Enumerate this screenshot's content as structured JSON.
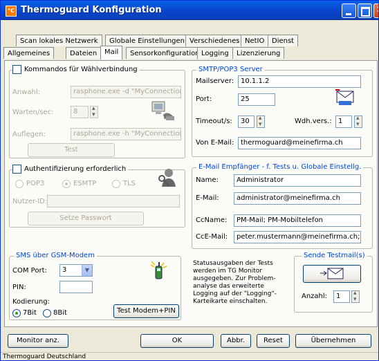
{
  "window": {
    "title": "Thermoguard Konfiguration",
    "icon_text": "°C"
  },
  "tabs_row1": [
    "Scan lokales Netzwerk",
    "Globale Einstellungen",
    "Verschiedenes",
    "NetIO",
    "Dienst"
  ],
  "tabs_row2": [
    "Allgemeines",
    "Dateien",
    "Mail",
    "Sensorkonfiguration",
    "Logging",
    "Lizenzierung"
  ],
  "selected_tab": "Mail",
  "dialup": {
    "title": "Kommandos für Wählverbindung",
    "dial_label": "Anwahl:",
    "dial_value": "rasphone.exe -d \"MyConnection",
    "wait_label": "Warten/sec:",
    "wait_value": "8",
    "hangup_label": "Auflegen:",
    "hangup_value": "rasphone.exe -h \"MyConnection",
    "test_button": "Test"
  },
  "auth": {
    "title": "Authentifizierung erforderlich",
    "options": [
      "POP3",
      "ESMTP",
      "TLS"
    ],
    "selected": "ESMTP",
    "user_label": "Nutzer-ID:",
    "user_value": "",
    "password_button": "Setze Passwort"
  },
  "sms": {
    "title": "SMS über GSM-Modem",
    "com_label": "COM Port:",
    "com_value": "3",
    "pin_label": "PIN:",
    "pin_value": "",
    "encoding_label": "Kodierung:",
    "encoding_options": [
      "7Bit",
      "8Bit"
    ],
    "encoding_selected": "7Bit",
    "test_button": "Test Modem+PIN"
  },
  "smtp": {
    "title": "SMTP/POP3 Server",
    "server_label": "Mailserver:",
    "server_value": "10.1.1.2",
    "port_label": "Port:",
    "port_value": "25",
    "timeout_label": "Timeout/s:",
    "timeout_value": "30",
    "retry_label": "Wdh.vers.:",
    "retry_value": "1",
    "from_label": "Von E-Mail:",
    "from_value": "thermoguard@meinefirma.ch"
  },
  "recipient": {
    "title": "E-Mail Empfänger - f. Tests u. Globale Einstellg.",
    "name_label": "Name:",
    "name_value": "Administrator",
    "email_label": "E-Mail:",
    "email_value": "administrator@meinefirma.ch",
    "ccname_label": "CcName:",
    "ccname_value": "PM-Mail; PM-Mobiltelefon",
    "ccemail_label": "CcE-Mail:",
    "ccemail_value": "peter.mustermann@meinefirma.ch; pe"
  },
  "info_text": "Statusausgaben der Tests werden im TG Monitor ausgegeben. Zur Problem-analyse das erweiterte Logging auf der \"Logging\"-Karteikarte einschalten.",
  "testmail": {
    "title": "Sende Testmail(s)",
    "count_label": "Anzahl:",
    "count_value": "1"
  },
  "buttons": {
    "monitor": "Monitor anz.",
    "ok": "OK",
    "cancel": "Abbr.",
    "reset": "Reset",
    "apply": "Übernehmen"
  },
  "status": "Thermoguard Deutschland",
  "colors": {
    "titlebar": "#0a5fe8",
    "group_title_blue": "#0046d5",
    "window_bg": "#ece9d8"
  }
}
